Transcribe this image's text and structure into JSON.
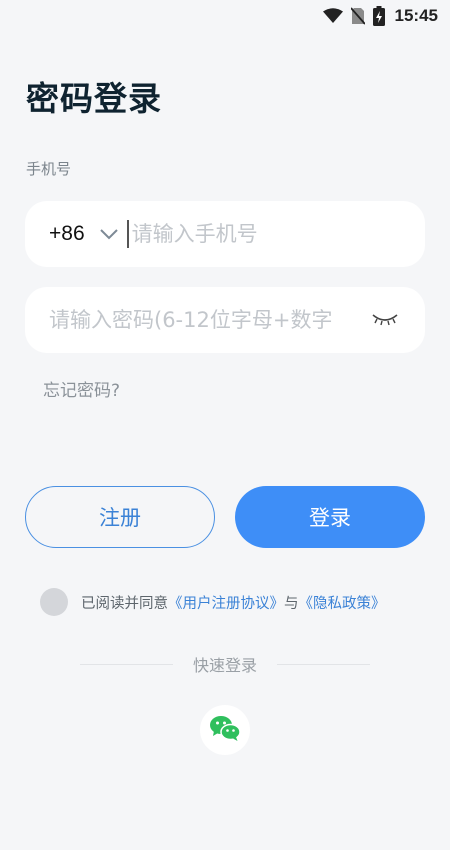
{
  "status_bar": {
    "time": "15:45"
  },
  "page_title": "密码登录",
  "phone_section": {
    "label": "手机号",
    "country_code": "+86",
    "placeholder": "请输入手机号"
  },
  "password_section": {
    "placeholder": "请输入密码(6-12位字母+数字"
  },
  "forgot_password": "忘记密码?",
  "buttons": {
    "register": "注册",
    "login": "登录"
  },
  "agreement": {
    "prefix": "已阅读并同意",
    "user_agreement": "《用户注册协议》",
    "conjunction": "与",
    "privacy_policy": "《隐私政策》"
  },
  "quick_login": {
    "label": "快速登录"
  },
  "colors": {
    "accent": "#3e8ef7",
    "wechat": "#2fbf5d"
  }
}
